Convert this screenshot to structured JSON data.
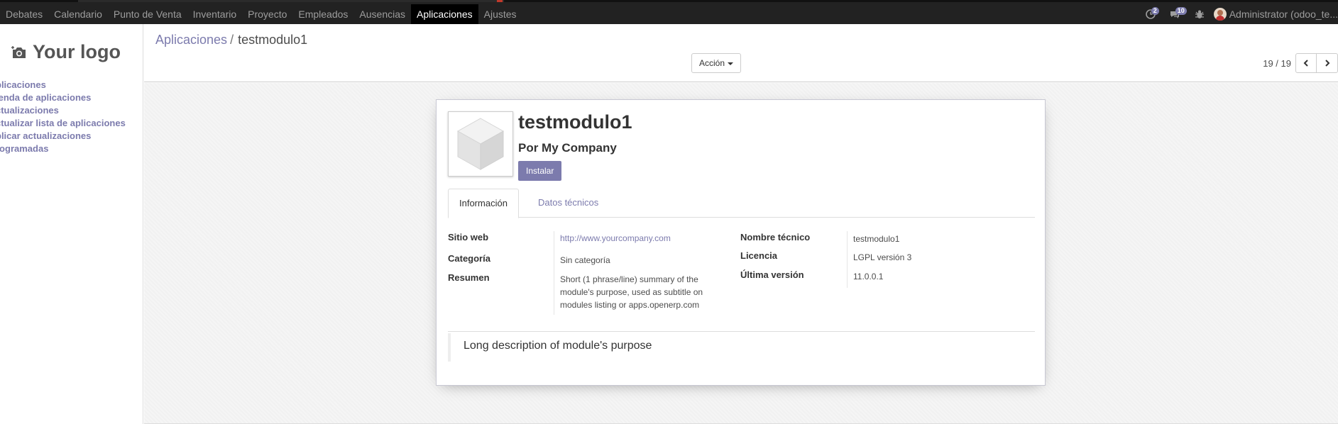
{
  "navbar": {
    "menu": [
      "Debates",
      "Calendario",
      "Punto de Venta",
      "Inventario",
      "Proyecto",
      "Empleados",
      "Ausencias",
      "Aplicaciones",
      "Ajustes"
    ],
    "active_index": 7,
    "systray": {
      "messages_count": "2",
      "chat_count": "10",
      "user_name": "Administrator (odoo_te..."
    }
  },
  "sidebar": {
    "logo_text": "Your logo",
    "items": [
      "plicaciones",
      "ienda de aplicaciones",
      "ctualizaciones",
      "ctualizar lista de aplicaciones",
      "plicar actualizaciones",
      "rogramadas"
    ]
  },
  "control_panel": {
    "breadcrumb_parent": "Aplicaciones",
    "breadcrumb_separator": "/",
    "breadcrumb_current": "testmodulo1",
    "action_label": "Acción",
    "pager_value": "19 / 19"
  },
  "form": {
    "title": "testmodulo1",
    "author": "Por My Company",
    "install_label": "Instalar",
    "tabs": [
      "Información",
      "Datos técnicos"
    ],
    "left_fields": [
      {
        "label": "Sitio web",
        "value": "http://www.yourcompany.com"
      },
      {
        "label": "Categoría",
        "value": "Sin categoría"
      },
      {
        "label": "Resumen",
        "value": "Short (1 phrase/line) summary of the module's purpose, used as subtitle on modules listing or apps.openerp.com"
      }
    ],
    "right_fields": [
      {
        "label": "Nombre técnico",
        "value": "testmodulo1"
      },
      {
        "label": "Licencia",
        "value": "LGPL versión 3"
      },
      {
        "label": "Última versión",
        "value": "11.0.0.1"
      }
    ],
    "description": "Long description of module's purpose"
  },
  "colors": {
    "navbar_bg": "#222222",
    "accent": "#7c7bad"
  }
}
